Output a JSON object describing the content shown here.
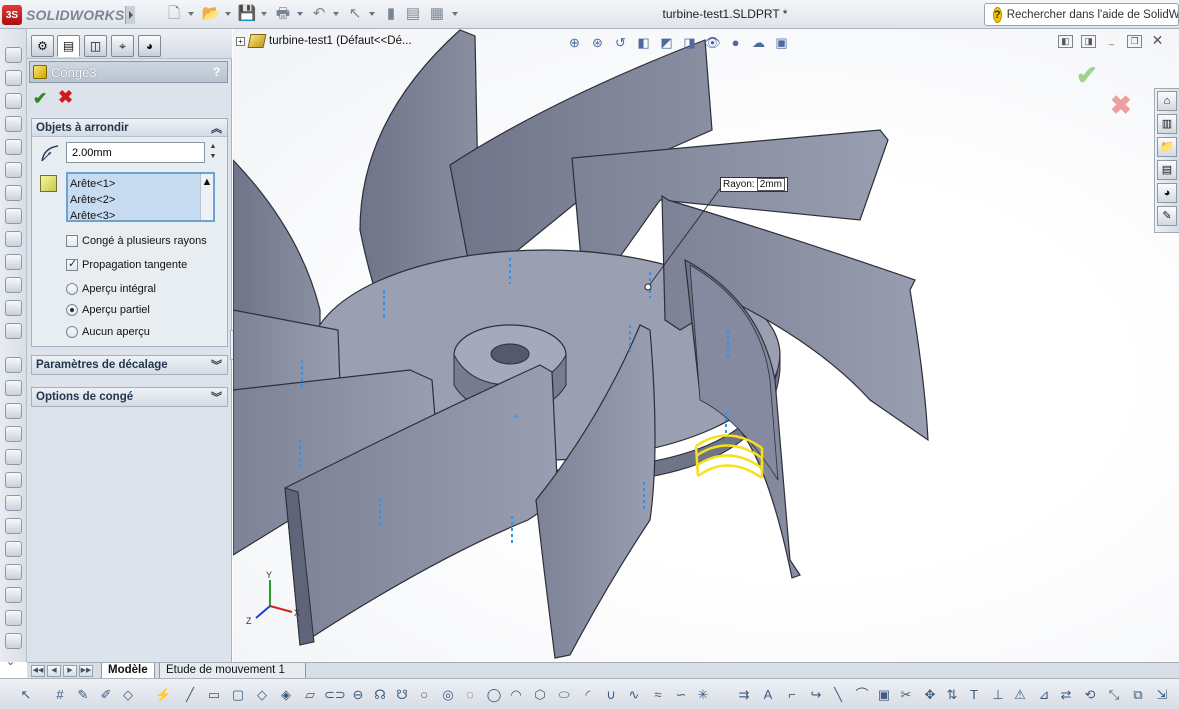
{
  "app": {
    "name": "SOLIDWORKS",
    "document_title": "turbine-test1.SLDPRT *",
    "help_search_placeholder": "Rechercher dans l'aide de SolidWorks"
  },
  "property_manager": {
    "title": "Congé3",
    "help_label": "?",
    "groups": {
      "objects": {
        "label": "Objets à arrondir",
        "radius_value": "2.00mm",
        "edges": [
          "Arête<1>",
          "Arête<2>",
          "Arête<3>"
        ],
        "multi_radius_label": "Congé à plusieurs rayons",
        "multi_radius_checked": false,
        "tangent_propagation_label": "Propagation tangente",
        "tangent_propagation_checked": true,
        "preview_options": [
          {
            "label": "Aperçu intégral",
            "selected": false
          },
          {
            "label": "Aperçu partiel",
            "selected": true
          },
          {
            "label": "Aucun aperçu",
            "selected": false
          }
        ]
      },
      "offset": {
        "label": "Paramètres de décalage"
      },
      "options": {
        "label": "Options de congé"
      }
    }
  },
  "viewport": {
    "tree_flyout_label": "turbine-test1  (Défaut<<Dé...",
    "callout": {
      "label": "Rayon:",
      "value": "2mm"
    }
  },
  "bottom_tabs": [
    {
      "label": "Modèle",
      "active": true
    },
    {
      "label": "Etude de mouvement 1",
      "active": false
    }
  ],
  "colors": {
    "model_face": "#8e93a6",
    "model_top": "#9ea3b6",
    "selection_yellow": "#f4e11a",
    "edge_blue": "#3a8fe0",
    "ok_green": "#2a8c22",
    "cancel_red": "#cc1d1d"
  }
}
